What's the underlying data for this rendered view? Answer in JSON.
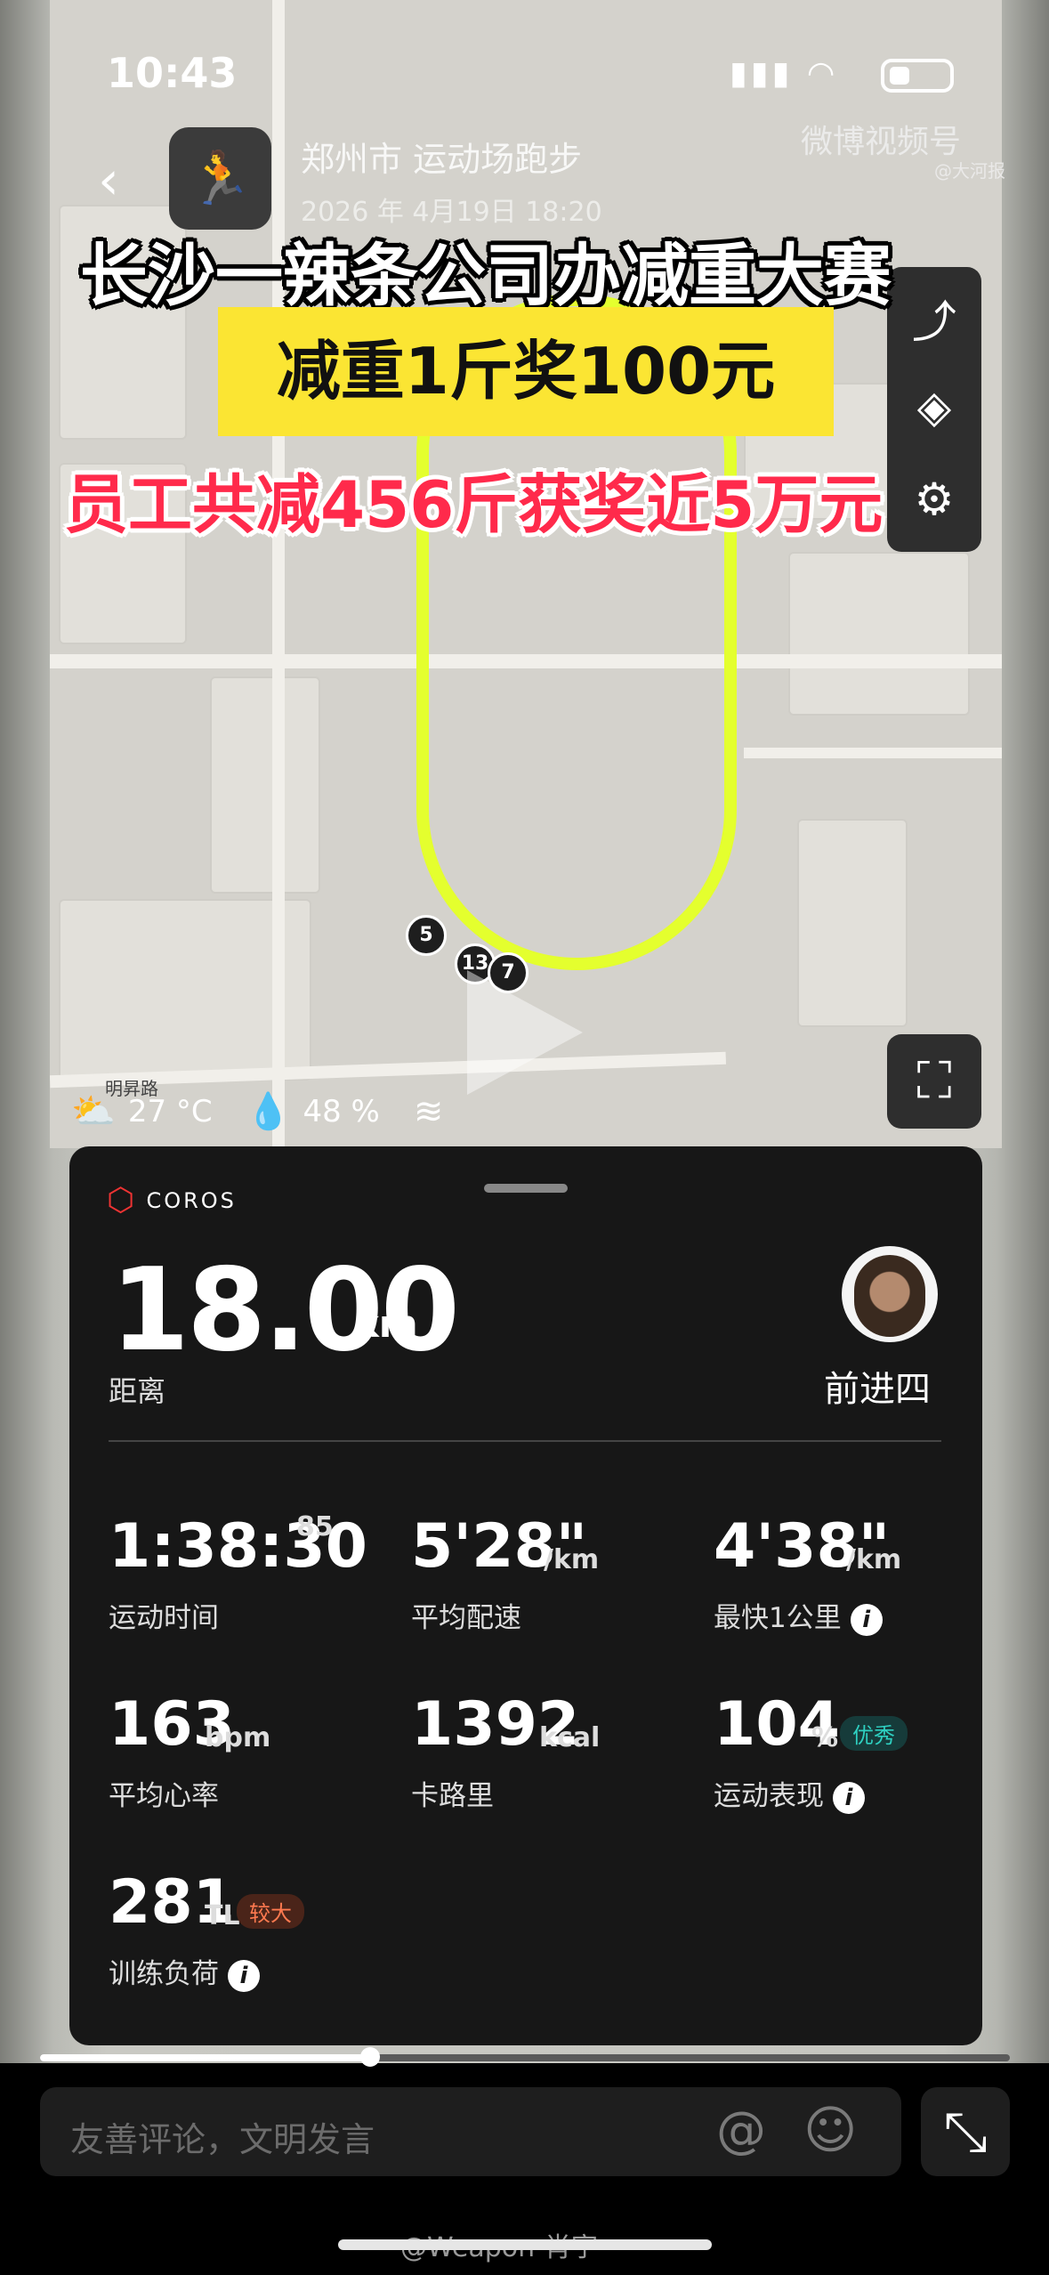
{
  "status_bar": {
    "time": "10:43"
  },
  "watermark": {
    "brand": "微博视频号",
    "source": "@大河报"
  },
  "app_header": {
    "back_glyph": "‹",
    "title": "郑州市 运动场跑步",
    "date": "2026 年 4月19日 18:20"
  },
  "captions": {
    "line1": "长沙一辣条公司办减重大赛",
    "line2": "减重1斤奖100元",
    "line3": "员工共减456斤获奖近5万元"
  },
  "map": {
    "street_label": "明昇路",
    "km_markers": [
      "5",
      "13",
      "7"
    ],
    "track_color": "#e4ff2e"
  },
  "weather": {
    "temperature": "27 °C",
    "humidity": "48 %"
  },
  "card": {
    "brand": "COROS",
    "distance": {
      "value": "18.00",
      "unit": "km",
      "label": "距离"
    },
    "user_name": "前进四",
    "metrics": {
      "duration": {
        "value": "1:38:30",
        "sub": "85",
        "label": "运动时间"
      },
      "avg_pace": {
        "value": "5'28\"",
        "unit": "/km",
        "label": "平均配速"
      },
      "fastest_km": {
        "value": "4'38\"",
        "unit": "/km",
        "label": "最快1公里"
      },
      "avg_hr": {
        "value": "163",
        "unit": "bpm",
        "label": "平均心率"
      },
      "calories": {
        "value": "1392",
        "unit": "kcal",
        "label": "卡路里"
      },
      "performance": {
        "value": "104",
        "unit": "%",
        "badge": "优秀",
        "label": "运动表现"
      },
      "training_load": {
        "value": "281",
        "unit": "TL",
        "badge": "较大",
        "label": "训练负荷"
      }
    },
    "colors": {
      "badge_good": "#2ecfc0",
      "badge_high": "#ff7a50"
    }
  },
  "player": {
    "progress": 0.34
  },
  "comment_bar": {
    "placeholder": "友善评论，文明发言",
    "at_glyph": "@"
  },
  "credit": "@Weapon-肖宇"
}
